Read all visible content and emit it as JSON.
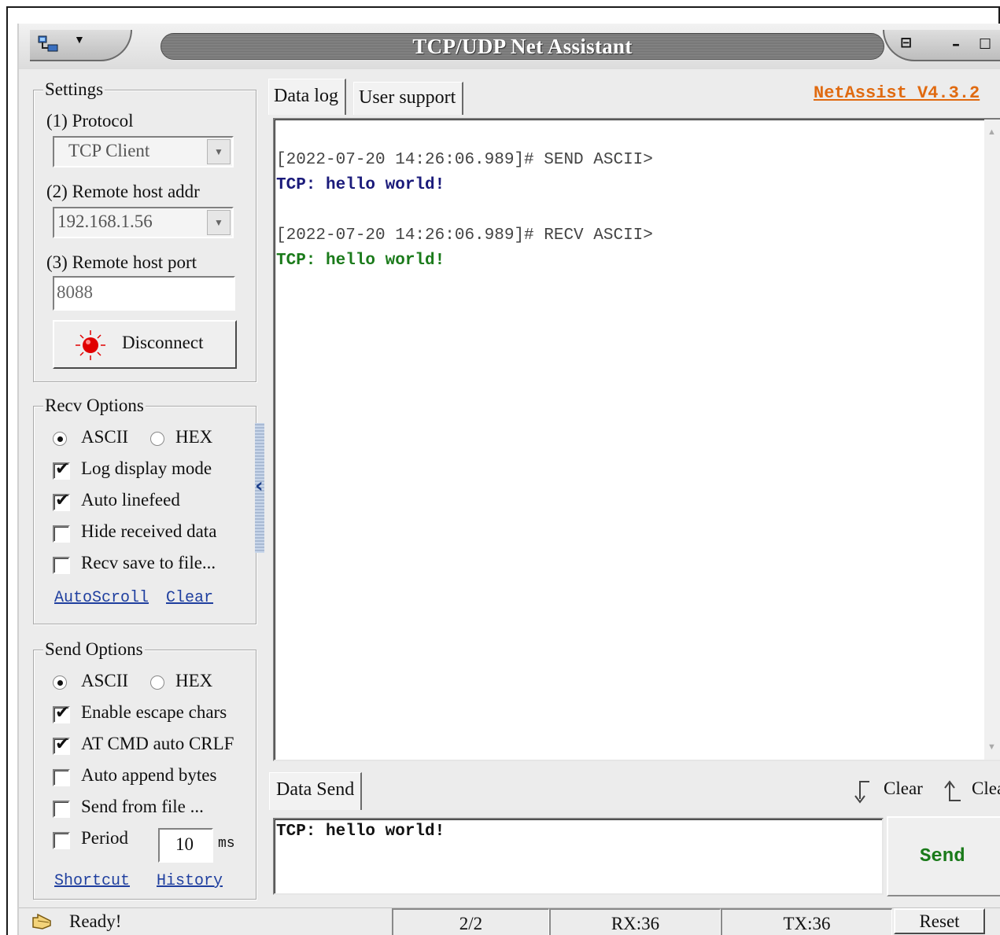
{
  "window": {
    "title": "TCP/UDP Net Assistant"
  },
  "settings": {
    "legend": "Settings",
    "protocol_label": "(1) Protocol",
    "protocol_value": "TCP Client",
    "host_label": "(2) Remote host addr",
    "host_value": "192.168.1.56",
    "port_label": "(3) Remote host port",
    "port_value": "8088",
    "connect_button": "Disconnect",
    "connection_state_color": "#e00000"
  },
  "recv_options": {
    "legend": "Recv Options",
    "ascii": "ASCII",
    "hex": "HEX",
    "selected": "ASCII",
    "checks": [
      {
        "label": "Log display mode",
        "checked": true
      },
      {
        "label": "Auto linefeed",
        "checked": true
      },
      {
        "label": "Hide received data",
        "checked": false
      },
      {
        "label": "Recv save to file...",
        "checked": false
      }
    ],
    "link_autoscroll": "AutoScroll",
    "link_clear": "Clear"
  },
  "send_options": {
    "legend": "Send Options",
    "ascii": "ASCII",
    "hex": "HEX",
    "selected": "ASCII",
    "checks": [
      {
        "label": "Enable escape chars",
        "checked": true
      },
      {
        "label": "AT CMD auto CRLF",
        "checked": true
      },
      {
        "label": "Auto append bytes",
        "checked": false
      },
      {
        "label": "Send from file ...",
        "checked": false
      }
    ],
    "period_label": "Period",
    "period_checked": false,
    "period_value": "10",
    "period_unit": "ms",
    "link_shortcut": "Shortcut",
    "link_history": "History"
  },
  "tabs": {
    "data_log": "Data log",
    "user_support": "User support"
  },
  "version": "NetAssist V4.3.2",
  "log": [
    {
      "text": "[2022-07-20 14:26:06.989]# SEND ASCII>",
      "color": "#444444"
    },
    {
      "text": "TCP: hello world!",
      "color": "#1a1a7a"
    },
    {
      "text": "[2022-07-20 14:26:06.989]# RECV ASCII>",
      "color": "#444444"
    },
    {
      "text": "TCP: hello world!",
      "color": "#1a7a1a"
    }
  ],
  "send_area": {
    "tab": "Data Send",
    "clear_label": "Clear",
    "clear_label_2": "Clear",
    "text": "TCP: hello world!",
    "send_button": "Send"
  },
  "status_bar": {
    "ready": "Ready!",
    "count": "2/2",
    "rx": "RX:36",
    "tx": "TX:36",
    "reset": "Reset"
  }
}
